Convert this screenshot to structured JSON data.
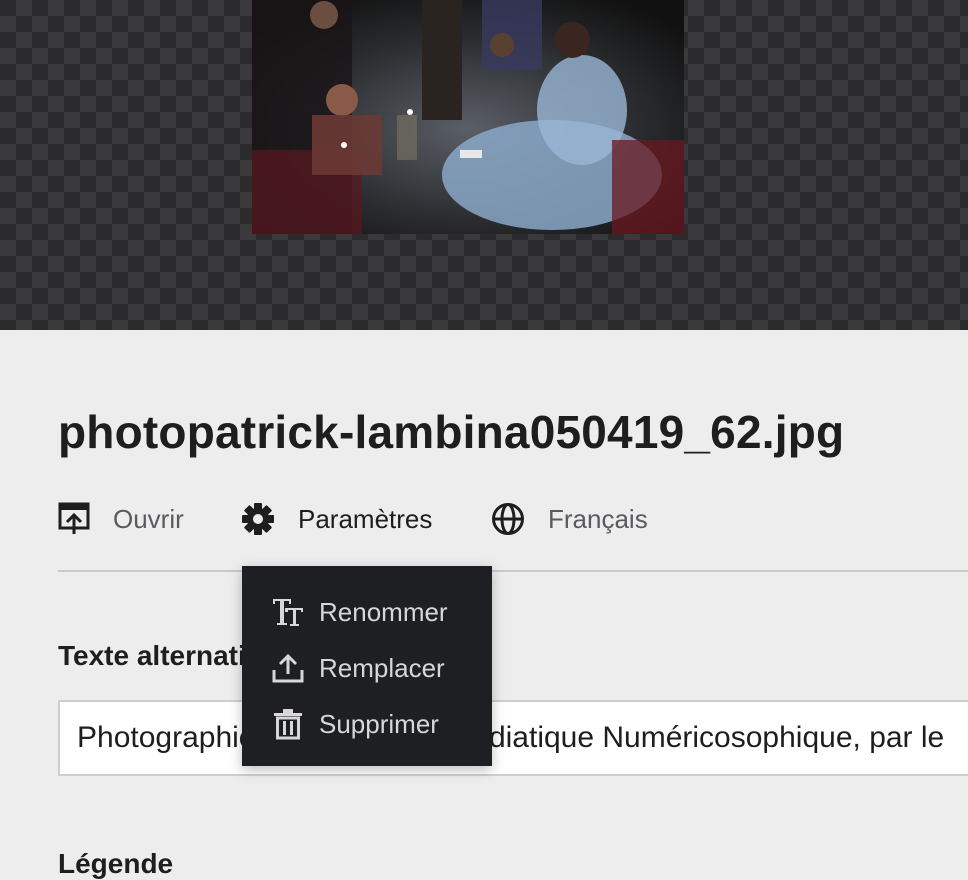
{
  "attachment": {
    "filename": "photopatrick-lambina050419_62.jpg"
  },
  "toolbar": {
    "open_label": "Ouvrir",
    "settings_label": "Paramètres",
    "language_label": "Français",
    "icons": {
      "open": "open-external-icon",
      "settings": "gear-icon",
      "language": "globe-icon"
    }
  },
  "settings_menu": {
    "items": [
      {
        "label": "Renommer",
        "icon": "text-rename-icon"
      },
      {
        "label": "Remplacer",
        "icon": "upload-icon"
      },
      {
        "label": "Supprimer",
        "icon": "trash-icon"
      }
    ]
  },
  "fields": {
    "alt_text": {
      "label": "Texte alternatif",
      "value": "Photographie de la Séance médiatique Numéricosophique, par le"
    },
    "caption": {
      "label": "Légende"
    }
  },
  "colors": {
    "page_background": "#ededed",
    "menu_background": "#1e1f22",
    "menu_text": "#d7d7d9",
    "text_primary": "#1e1e1e",
    "text_secondary": "#5b5b5f"
  }
}
